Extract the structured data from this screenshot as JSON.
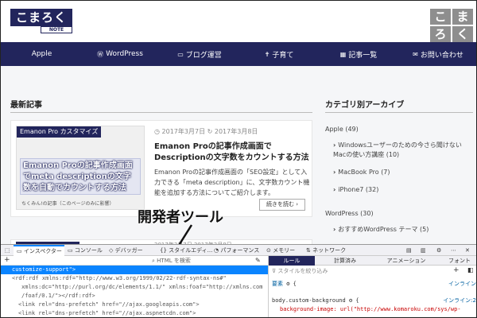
{
  "header": {
    "logo_main": "こまろく",
    "logo_sub": "NOTE",
    "corner_logo": [
      "こ",
      "ま",
      "ろ",
      "く"
    ]
  },
  "nav": {
    "items": [
      {
        "icon": "apple-icon",
        "glyph": "",
        "label": "Apple"
      },
      {
        "icon": "wordpress-icon",
        "glyph": "Ⓦ",
        "label": "WordPress"
      },
      {
        "icon": "monitor-icon",
        "glyph": "▭",
        "label": "ブログ運営"
      },
      {
        "icon": "child-icon",
        "glyph": "✝",
        "label": "子育て"
      },
      {
        "icon": "articles-icon",
        "glyph": "▦",
        "label": "記事一覧"
      },
      {
        "icon": "mail-icon",
        "glyph": "✉",
        "label": "お問い合わせ"
      }
    ]
  },
  "main": {
    "section_title": "最新記事",
    "card": {
      "thumb_tag": "Emanon Pro カスタマイズ",
      "thumb_text": "Emanon Proの記事作成画面でmeta descriptionの文字数を自動でカウントする方法",
      "thumb_caption": "ちくみん!の記事（このページのみに影響）",
      "date_posted": "2017年3月7日",
      "date_updated": "2017年3月8日",
      "title": "Emanon Proの記事作成画面でDescriptionの文字数をカウントする方法",
      "excerpt": "Emanon Proの記事作成画面の「SEO設定」として入力できる「meta description」に、文字数カウント機能を追加する方法についてご紹介します。",
      "read_more": "続きを読む ›"
    },
    "card2_dates": "2017年3月7日  2017年3月8日"
  },
  "overlay_label": "開発者ツール",
  "sidebar": {
    "title": "カテゴリ別アーカイブ",
    "items": [
      {
        "label": "Apple (49)",
        "level": 0
      },
      {
        "label": "Windowsユーザーのための今さら聞けないMacの使い方講座 (10)",
        "level": 1
      },
      {
        "label": "MacBook Pro (7)",
        "level": 1
      },
      {
        "label": "iPhone7 (32)",
        "level": 1
      },
      {
        "label": "WordPress (30)",
        "level": 0
      },
      {
        "label": "おすすめWordPress テーマ (5)",
        "level": 1
      }
    ]
  },
  "devtools": {
    "tabs": [
      "インスペクター",
      "コンソール",
      "デバッガー",
      "スタイルエディ...",
      "パフォーマンス",
      "メモリー",
      "ネットワーク"
    ],
    "search_placeholder": "HTML を検索",
    "html_lines": [
      "customize-support\">",
      "<rdf:rdf xmlns:rdf=\"http://www.w3.org/1999/02/22-rdf-syntax-ns#\"",
      "xmlns:dc=\"http://purl.org/dc/elements/1.1/\" xmlns:foaf=\"http://xmlns.com",
      "/foaf/0.1/\"></rdf:rdf>",
      "<link rel=\"dns-prefetch\" href=\"//ajax.googleapis.com\">",
      "<link rel=\"dns-prefetch\" href=\"//ajax.aspnetcdn.com\">"
    ],
    "subtabs": [
      "ルール",
      "計算済み",
      "アニメーション",
      "フォント"
    ],
    "filter_placeholder": "スタイルを絞り込み",
    "css": {
      "element_label": "要素",
      "element_brace": "{",
      "element_source": "インライン",
      "rule_selector": "body.custom-background",
      "rule_source": "インライン:2",
      "rule_prop": "background-image: url(\"http://www.komaroku.com/sys/wp-"
    }
  }
}
